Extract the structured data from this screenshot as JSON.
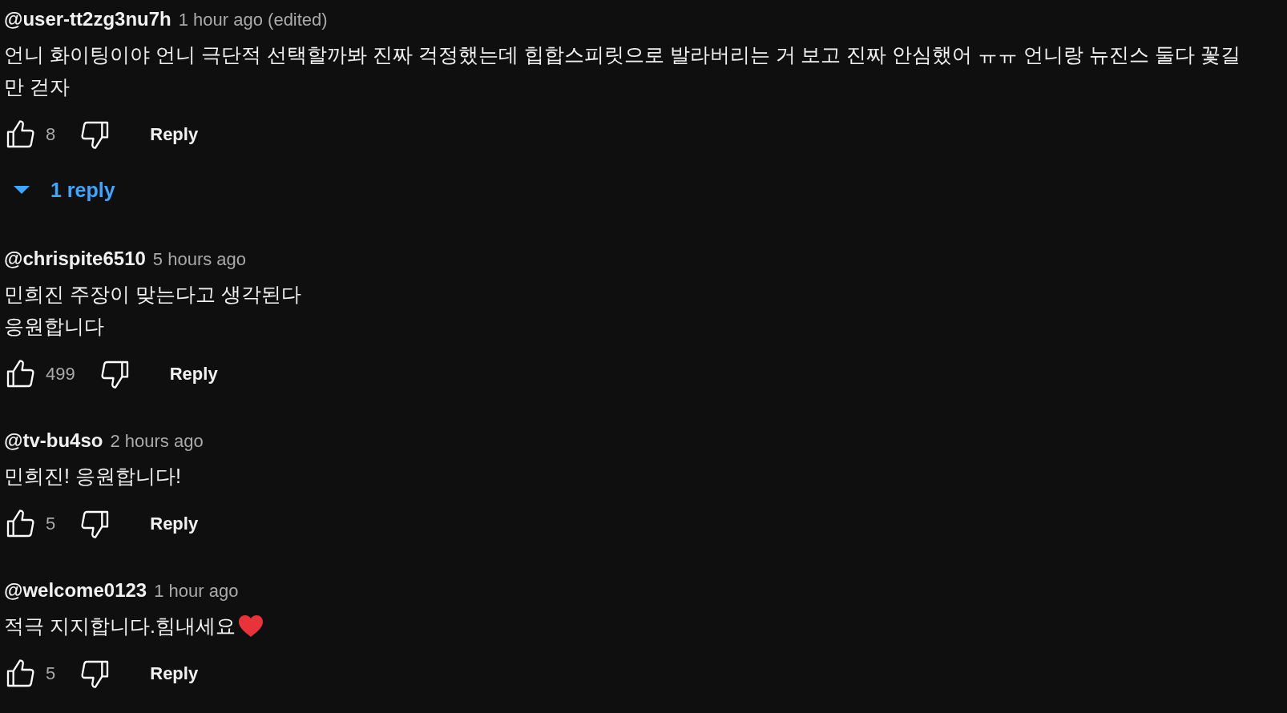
{
  "comments": [
    {
      "author": "@user-tt2zg3nu7h",
      "time": "1 hour ago (edited)",
      "text": "언니 화이팅이야 언니 극단적 선택할까봐 진짜 걱정했는데 힙합스피릿으로 발라버리는 거 보고 진짜 안심했어 ㅠㅠ 언니랑 뉴진스 둘다 꽃길만 걷자",
      "likes": "8",
      "reply_label": "Reply",
      "replies_toggle": {
        "label": "1 reply",
        "expanded": false
      }
    },
    {
      "author": "@chrispite6510",
      "time": "5 hours ago",
      "text": "민희진 주장이 맞는다고 생각된다\n응원합니다",
      "likes": "499",
      "reply_label": "Reply"
    },
    {
      "author": "@tv-bu4so",
      "time": "2 hours ago",
      "text": "민희진! 응원합니다!",
      "likes": "5",
      "reply_label": "Reply"
    },
    {
      "author": "@welcome0123",
      "time": "1 hour ago",
      "text": "적극 지지합니다.힘내세요",
      "heart_emoji": true,
      "likes": "5",
      "reply_label": "Reply"
    }
  ]
}
